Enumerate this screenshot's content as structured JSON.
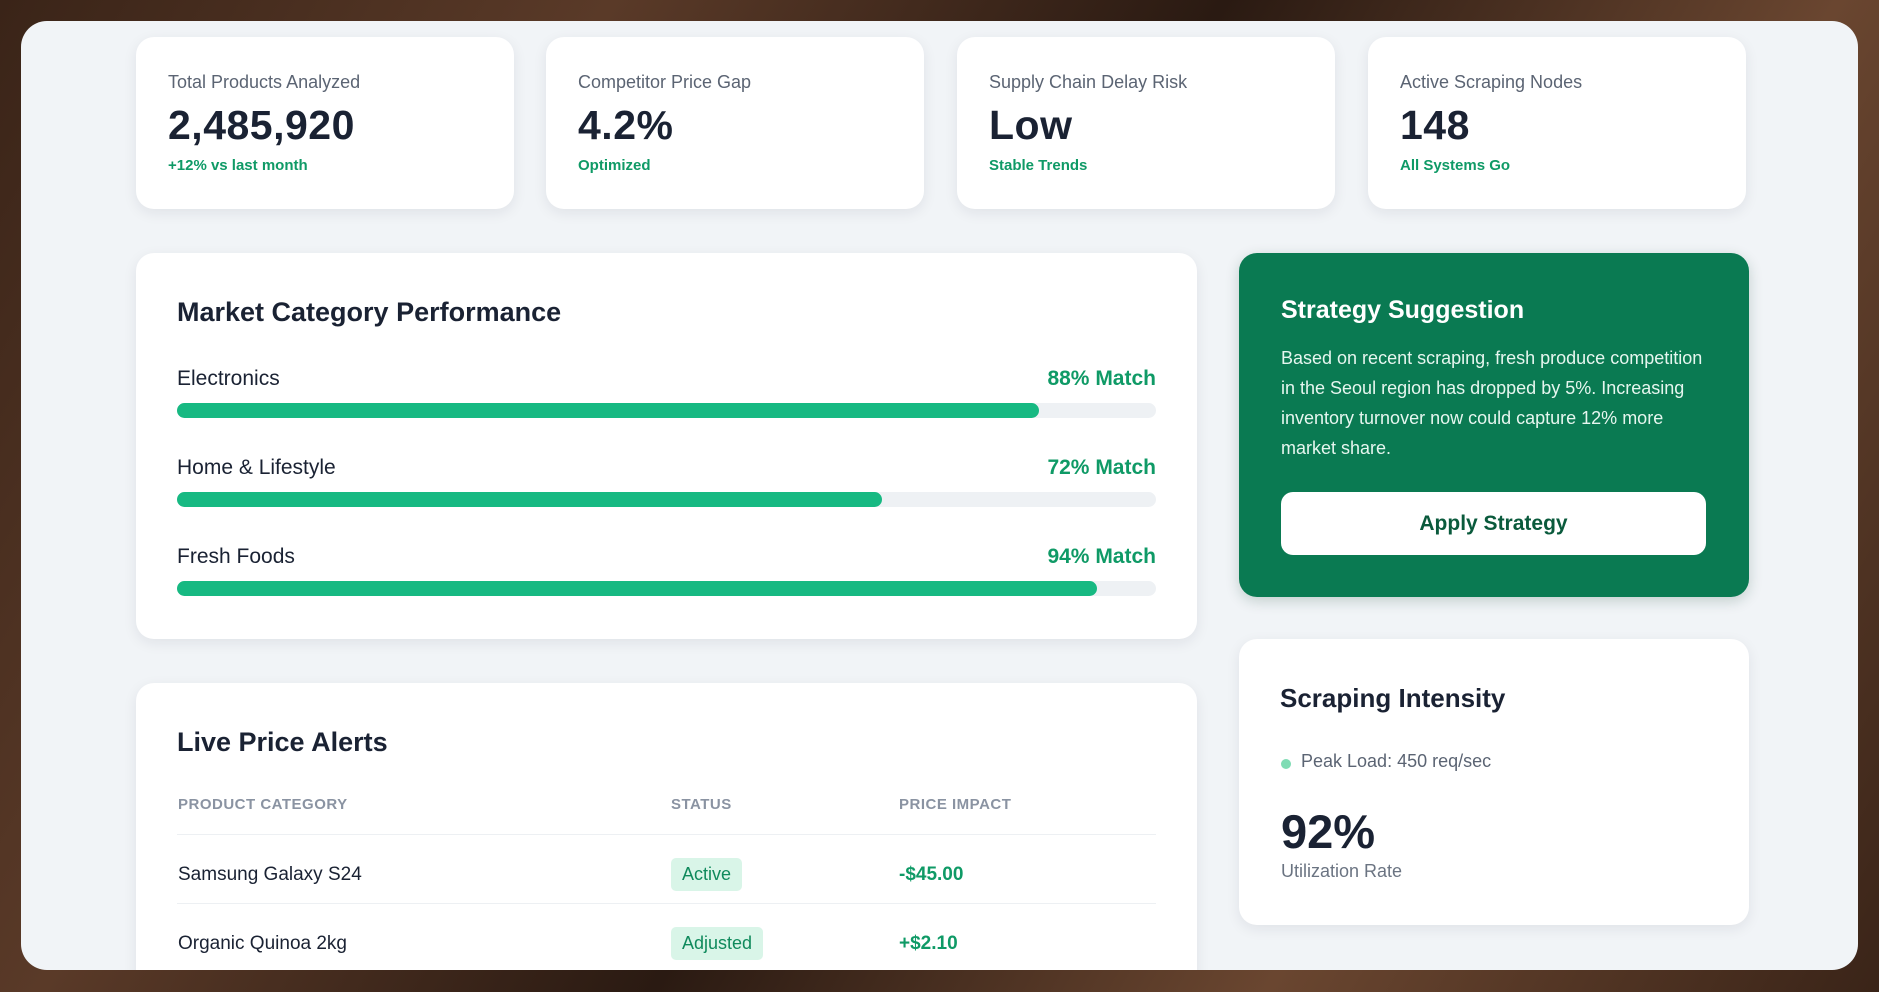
{
  "stats": [
    {
      "label": "Total Products Analyzed",
      "value": "2,485,920",
      "sub": "+12% vs last month"
    },
    {
      "label": "Competitor Price Gap",
      "value": "4.2%",
      "sub": "Optimized"
    },
    {
      "label": "Supply Chain Delay Risk",
      "value": "Low",
      "sub": "Stable Trends"
    },
    {
      "label": "Active Scraping Nodes",
      "value": "148",
      "sub": "All Systems Go"
    }
  ],
  "performance": {
    "title": "Market Category Performance",
    "categories": [
      {
        "name": "Electronics",
        "pct_label": "88% Match",
        "value": 88
      },
      {
        "name": "Home & Lifestyle",
        "pct_label": "72% Match",
        "value": 72
      },
      {
        "name": "Fresh Foods",
        "pct_label": "94% Match",
        "value": 94
      }
    ]
  },
  "alerts": {
    "title": "Live Price Alerts",
    "columns": [
      "PRODUCT CATEGORY",
      "STATUS",
      "PRICE IMPACT"
    ],
    "rows": [
      {
        "product": "Samsung Galaxy S24",
        "status": "Active",
        "impact": "-$45.00"
      },
      {
        "product": "Organic Quinoa 2kg",
        "status": "Adjusted",
        "impact": "+$2.10"
      }
    ]
  },
  "strategy": {
    "title": "Strategy Suggestion",
    "text": "Based on recent scraping, fresh produce competition in the Seoul region has dropped by 5%. Increasing inventory turnover now could capture 12% more market share.",
    "button": "Apply Strategy"
  },
  "intensity": {
    "title": "Scraping Intensity",
    "peak": "Peak Load: 450 req/sec",
    "value": "92%",
    "caption": "Utilization Rate"
  },
  "colors": {
    "accent": "#17b982",
    "strategy_bg": "#0a7a52",
    "positive": "#0f9a66"
  }
}
